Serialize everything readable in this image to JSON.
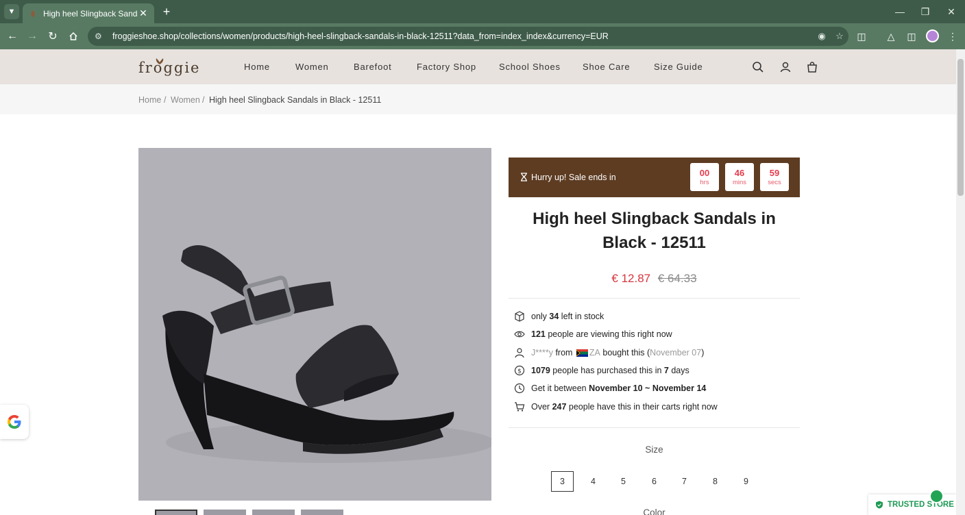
{
  "browser": {
    "tab_title": "High heel Slingback Sandals in",
    "url": "froggieshoe.shop/collections/women/products/high-heel-slingback-sandals-in-black-12511?data_from=index_index&currency=EUR"
  },
  "site": {
    "logo_text": "froggie",
    "nav": [
      "Home",
      "Women",
      "Barefoot",
      "Factory Shop",
      "School Shoes",
      "Shoe Care",
      "Size Guide"
    ]
  },
  "breadcrumb": {
    "items": [
      "Home",
      "Women"
    ],
    "separator": "/",
    "current": "High heel Slingback Sandals in Black - 12511"
  },
  "countdown": {
    "label": "Hurry up!  Sale ends in",
    "hours": "00",
    "hours_unit": "hrs",
    "mins": "46",
    "mins_unit": "mins",
    "secs": "59",
    "secs_unit": "secs"
  },
  "product": {
    "title": "High heel Slingback Sandals in Black - 12511",
    "sale_price": "€ 12.87",
    "original_price": "€ 64.33"
  },
  "info": {
    "stock_pre": "only ",
    "stock_count": "34",
    "stock_post": " left in stock",
    "viewing_count": "121",
    "viewing_post": " people are viewing this right now",
    "buyer_name": "J****y",
    "buyer_from": " from ",
    "buyer_country": "ZA",
    "buyer_post": " bought this (",
    "buyer_date": "November 07",
    "buyer_close": ")",
    "purchased_count": "1079",
    "purchased_mid": " people has purchased this in ",
    "purchased_days": "7",
    "purchased_post": " days",
    "delivery_pre": "Get it between ",
    "delivery_range": "November 10 ~ November 14",
    "carts_pre": "Over ",
    "carts_count": "247",
    "carts_post": " people have this in their carts right now"
  },
  "size": {
    "label": "Size",
    "options": [
      "3",
      "4",
      "5",
      "6",
      "7",
      "8",
      "9"
    ],
    "selected": "3"
  },
  "color_label": "Color",
  "trusted_store": "TRUSTED STORE",
  "colors": {
    "tab_bar": "#3e5b49",
    "toolbar": "#587a63",
    "header_bg": "#e7e2de",
    "countdown_bg": "#5d3c22",
    "sale_red": "#d6353d",
    "trusted_green": "#1e9a54"
  }
}
